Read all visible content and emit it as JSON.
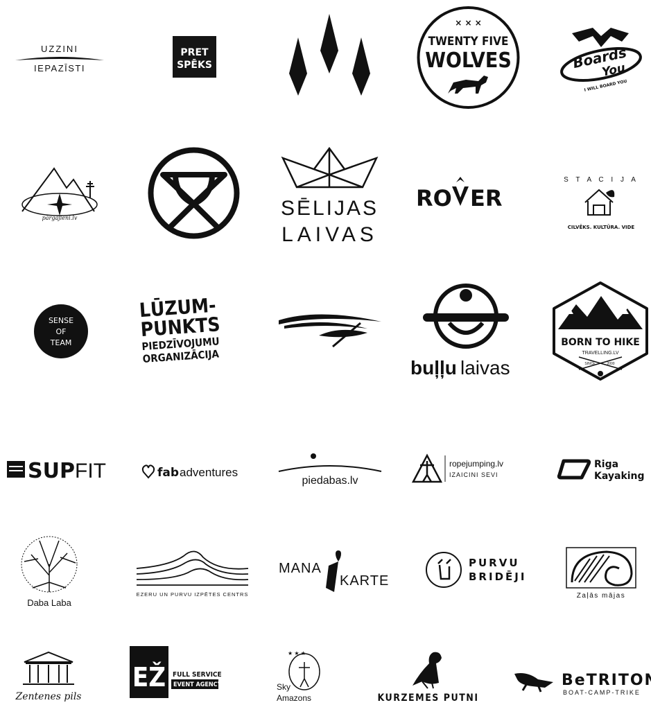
{
  "logos": {
    "uzzini": {
      "line1": "UZZINI",
      "line2": "IEPAZĪSTI"
    },
    "pret_speks": {
      "line1": "PRET",
      "line2": "SPĒKS"
    },
    "wolves": {
      "line1": "TWENTY FIVE",
      "line2": "WOLVES",
      "marks": "× × ×"
    },
    "boards": {
      "line1": "Boards",
      "line2": "You",
      "tagline": "I WILL BOARD YOU"
    },
    "pargajieni": {
      "caption": "pārgājieni.lv"
    },
    "selijas": {
      "line1": "SĒLIJAS",
      "line2": "LAIVAS"
    },
    "rover": {
      "part1": "RO",
      "part2": "ER"
    },
    "stacija": {
      "arc": "S T A C I J A",
      "tagline": "CILVĒKS. KULTŪRA. VIDE"
    },
    "sense": {
      "line1": "SENSE",
      "line2": "OF",
      "line3": "TEAM"
    },
    "luzumpunkts": {
      "line1": "LŪZUM-",
      "line2": "PUNKTS",
      "line3": "PIEDZĪVOJUMU",
      "line4": "ORGANIZĀCIJA"
    },
    "bullu": {
      "part1": "buļļu",
      "part2": "laivas"
    },
    "born": {
      "title": "BORN TO HIKE",
      "sub": "TRAVELLING.LV",
      "since_left": "SINCE",
      "since_right": "2000"
    },
    "supfit": {
      "part1": "SUP",
      "part2": "FIT"
    },
    "fab": {
      "part1": "fab",
      "part2": "adventures"
    },
    "piedabas": {
      "text": "piedabas.lv"
    },
    "rope": {
      "line1": "ropejumping.lv",
      "line2": "IZAICINI SEVI"
    },
    "riga": {
      "line1": "Riga",
      "line2": "Kayaking"
    },
    "daba": {
      "caption": "Daba Laba"
    },
    "ezeru": {
      "caption": "EZERU UN PURVU IZPĒTES CENTRS"
    },
    "mana": {
      "part1": "MANA",
      "part2": "KARTE"
    },
    "purvu": {
      "line1": "PURVU",
      "line2": "BRIDĒJI"
    },
    "zalas": {
      "caption": "Zaļās mājas"
    },
    "zentenes": {
      "caption": "Zentenes pils"
    },
    "ezi": {
      "mark": "EŽ",
      "line1": "FULL SERVICE",
      "line2": "EVENT AGENCY"
    },
    "sky": {
      "line1": "Sky",
      "line2": "Amazons"
    },
    "kurzemes": {
      "caption": "KURZEMES PUTNI"
    },
    "betriton": {
      "title": "BeTRITON",
      "sub": "BOAT-CAMP-TRIKE"
    }
  }
}
